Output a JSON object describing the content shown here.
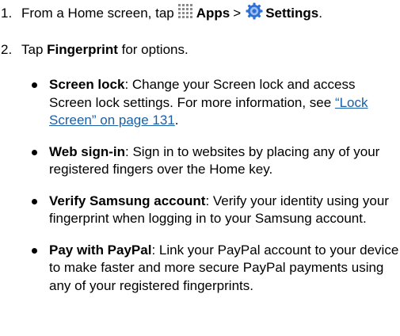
{
  "steps": [
    {
      "number": "1.",
      "intro": "From a Home screen, tap",
      "apps_label": "Apps",
      "separator": ">",
      "settings_label": "Settings",
      "end": "."
    },
    {
      "number": "2.",
      "tap": "Tap",
      "fingerprint_label": "Fingerprint",
      "rest": "for options."
    }
  ],
  "options": [
    {
      "term": "Screen lock",
      "text_before": ": Change your Screen lock and access Screen lock settings. For more information, see",
      "link_text": "“Lock Screen” on page 131",
      "text_after": "."
    },
    {
      "term": "Web sign-in",
      "text": ": Sign in to websites by placing any of your registered fingers over the Home key."
    },
    {
      "term": "Verify Samsung account",
      "text": ": Verify your identity using your fingerprint when logging in to your Samsung account."
    },
    {
      "term": "Pay with PayPal",
      "text": ": Link your PayPal account to your device to make faster and more secure PayPal payments using any of your registered fingerprints."
    }
  ],
  "icons": {
    "apps": "apps-grid-icon",
    "settings": "settings-gear-icon"
  },
  "colors": {
    "link": "#1a5fa8",
    "apps_icon": "#8a8a8a",
    "settings_icon_outer": "#2f6fd6",
    "settings_icon_inner": "#9fc1ef"
  }
}
